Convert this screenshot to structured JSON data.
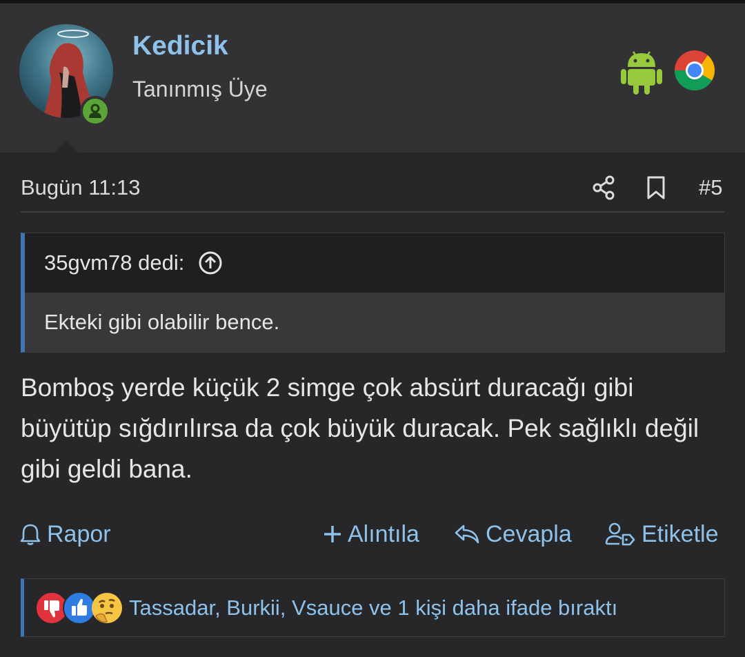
{
  "user": {
    "name": "Kedicik",
    "title": "Tanınmış Üye"
  },
  "post": {
    "date": "Bugün 11:13",
    "number": "#5"
  },
  "quote": {
    "author_line": "35gvm78 dedi:",
    "text": "Ekteki gibi olabilir bence."
  },
  "message": {
    "text": "Bomboş yerde küçük 2 simge çok absürt duracağı gibi büyütüp sığdırılırsa da çok büyük duracak. Pek sağlıklı değil gibi geldi bana."
  },
  "actions": {
    "report": "Rapor",
    "quote": "Alıntıla",
    "reply": "Cevapla",
    "tag": "Etiketle"
  },
  "reactions": {
    "summary": "Tassadar, Burkii, Vsauce ve 1 kişi daha ifade bıraktı",
    "icons": [
      "thumbs-down-icon",
      "thumbs-up-icon",
      "thinking-face-icon"
    ]
  },
  "colors": {
    "accent": "#8ec2ea",
    "quote_bar": "#3f75b3",
    "online": "#5aa535"
  }
}
